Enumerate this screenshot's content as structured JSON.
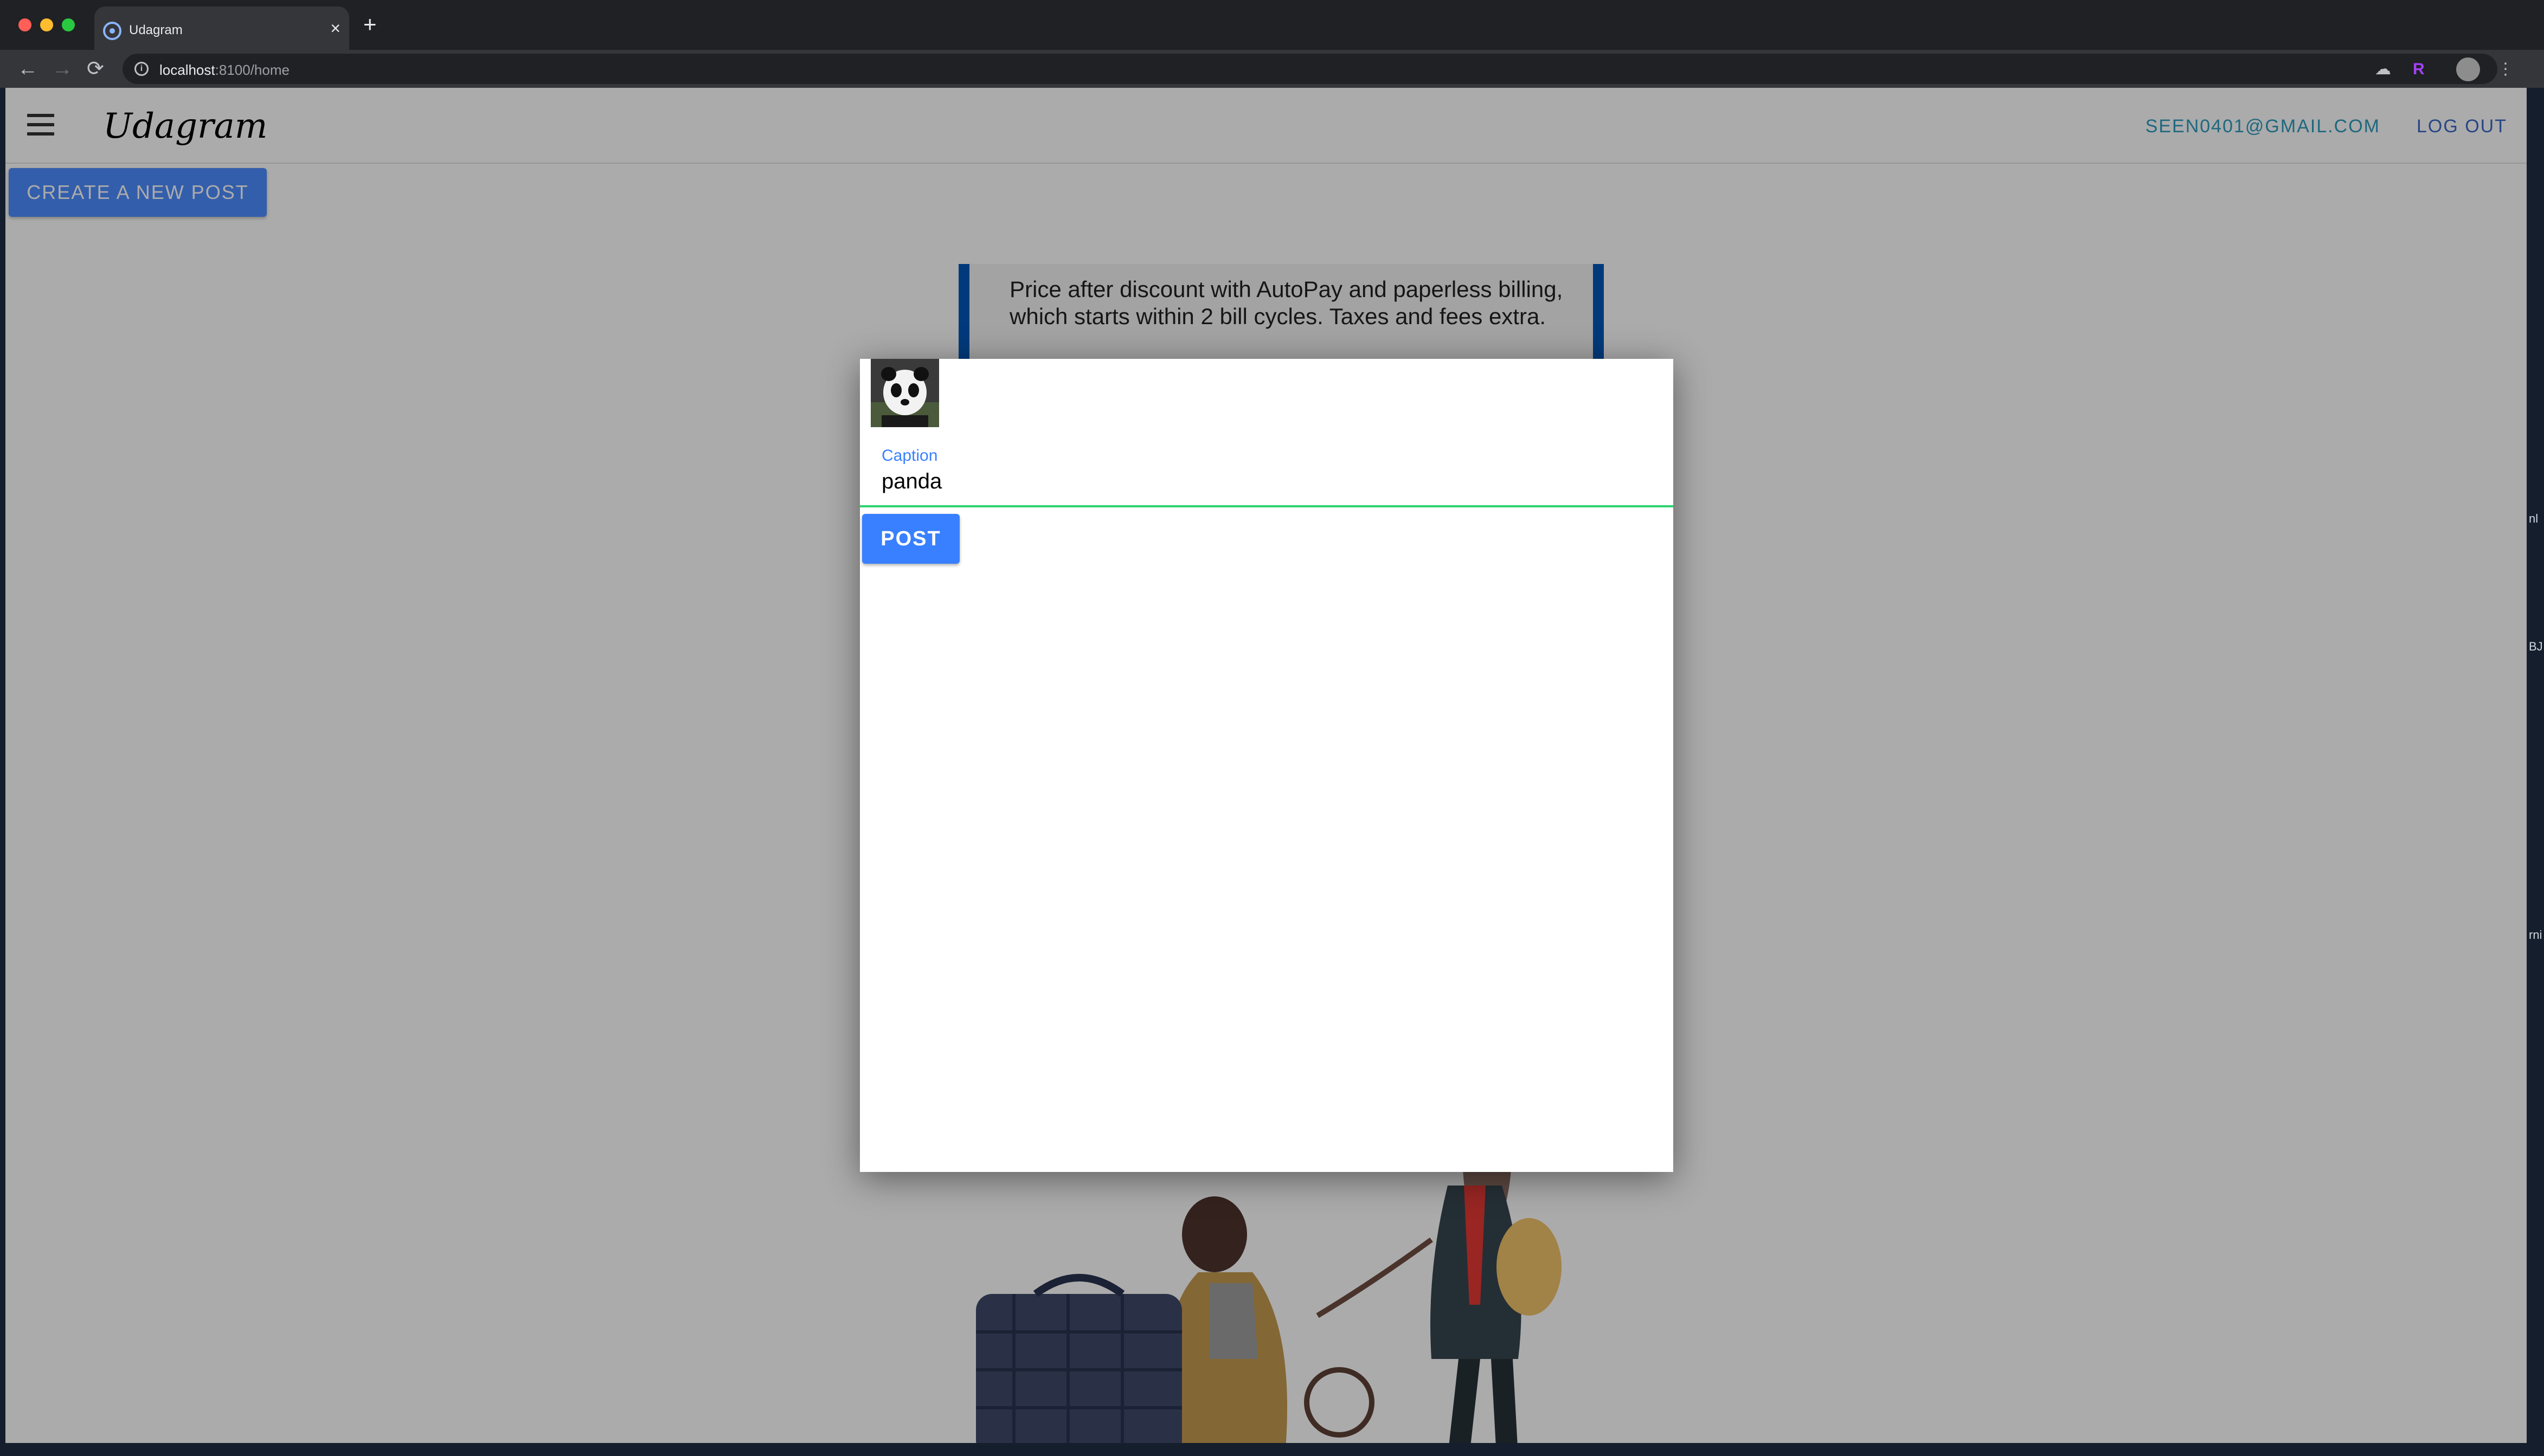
{
  "browser": {
    "tab_title": "Udagram",
    "tab_close": "×",
    "new_tab": "+",
    "url_host": "localhost",
    "url_rest": ":8100/home",
    "back_glyph": "←",
    "forward_glyph": "→",
    "reload_glyph": "⟳",
    "star_glyph": "☆",
    "menu_glyph": "⋮",
    "ext_glyphs": [
      "☁",
      "R"
    ]
  },
  "header": {
    "logo": "Udagram",
    "user_email": "SEEN0401@GMAIL.COM",
    "logout_label": "LOG OUT"
  },
  "actions": {
    "create_label": "CREATE A NEW POST"
  },
  "feed": {
    "ad_line_1": "Price after discount with AutoPay and paperless billing,",
    "ad_line_2": "which starts within 2 bill cycles. Taxes and fees extra."
  },
  "modal": {
    "caption_label": "Caption",
    "caption_value": "panda",
    "post_label": "POST"
  },
  "colors": {
    "primary": "#3880ff",
    "success": "#2dd36f",
    "header_link_email": "#2d9cbf",
    "header_link_logout": "#3c68c8"
  }
}
